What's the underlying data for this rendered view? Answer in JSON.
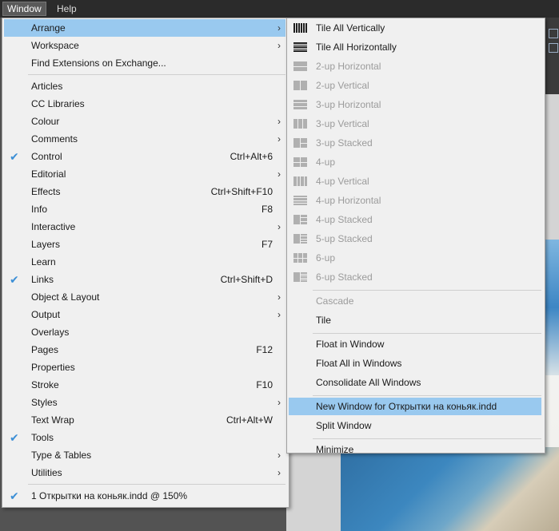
{
  "menubar": {
    "items": [
      {
        "label": "Window"
      },
      {
        "label": "Help"
      }
    ]
  },
  "window_menu": {
    "items": [
      {
        "label": "Arrange",
        "submenu": true,
        "highlight": true
      },
      {
        "label": "Workspace",
        "submenu": true
      },
      {
        "label": "Find Extensions on Exchange..."
      },
      {
        "sep": true
      },
      {
        "label": "Articles"
      },
      {
        "label": "CC Libraries"
      },
      {
        "label": "Colour",
        "submenu": true
      },
      {
        "label": "Comments",
        "submenu": true
      },
      {
        "label": "Control",
        "shortcut": "Ctrl+Alt+6",
        "checked": true
      },
      {
        "label": "Editorial",
        "submenu": true
      },
      {
        "label": "Effects",
        "shortcut": "Ctrl+Shift+F10"
      },
      {
        "label": "Info",
        "shortcut": "F8"
      },
      {
        "label": "Interactive",
        "submenu": true
      },
      {
        "label": "Layers",
        "shortcut": "F7"
      },
      {
        "label": "Learn"
      },
      {
        "label": "Links",
        "shortcut": "Ctrl+Shift+D",
        "checked": true
      },
      {
        "label": "Object & Layout",
        "submenu": true
      },
      {
        "label": "Output",
        "submenu": true
      },
      {
        "label": "Overlays"
      },
      {
        "label": "Pages",
        "shortcut": "F12"
      },
      {
        "label": "Properties"
      },
      {
        "label": "Stroke",
        "shortcut": "F10"
      },
      {
        "label": "Styles",
        "submenu": true
      },
      {
        "label": "Text Wrap",
        "shortcut": "Ctrl+Alt+W"
      },
      {
        "label": "Tools",
        "checked": true
      },
      {
        "label": "Type & Tables",
        "submenu": true
      },
      {
        "label": "Utilities",
        "submenu": true
      },
      {
        "sep": true
      },
      {
        "label": "1 Открытки на коньяк.indd @ 150%",
        "checked": true
      }
    ]
  },
  "arrange_menu": {
    "items": [
      {
        "label": "Tile All Vertically",
        "icon": "tile-vertical-icon"
      },
      {
        "label": "Tile All Horizontally",
        "icon": "tile-horizontal-icon"
      },
      {
        "label": "2-up Horizontal",
        "icon": "2up-horizontal-icon",
        "disabled": true
      },
      {
        "label": "2-up Vertical",
        "icon": "2up-vertical-icon",
        "disabled": true
      },
      {
        "label": "3-up Horizontal",
        "icon": "3up-horizontal-icon",
        "disabled": true
      },
      {
        "label": "3-up Vertical",
        "icon": "3up-vertical-icon",
        "disabled": true
      },
      {
        "label": "3-up Stacked",
        "icon": "3up-stacked-icon",
        "disabled": true
      },
      {
        "label": "4-up",
        "icon": "4up-icon",
        "disabled": true
      },
      {
        "label": "4-up Vertical",
        "icon": "4up-vertical-icon",
        "disabled": true
      },
      {
        "label": "4-up Horizontal",
        "icon": "4up-horizontal-icon",
        "disabled": true
      },
      {
        "label": "4-up Stacked",
        "icon": "4up-stacked-icon",
        "disabled": true
      },
      {
        "label": "5-up Stacked",
        "icon": "5up-stacked-icon",
        "disabled": true
      },
      {
        "label": "6-up",
        "icon": "6up-icon",
        "disabled": true
      },
      {
        "label": "6-up Stacked",
        "icon": "6up-stacked-icon",
        "disabled": true
      },
      {
        "sep": true
      },
      {
        "label": "Cascade",
        "disabled": true
      },
      {
        "label": "Tile"
      },
      {
        "sep": true
      },
      {
        "label": "Float in Window"
      },
      {
        "label": "Float All in Windows"
      },
      {
        "label": "Consolidate All Windows"
      },
      {
        "sep": true
      },
      {
        "label": "New Window for Открытки на коньяк.indd",
        "highlight": true
      },
      {
        "label": "Split Window"
      },
      {
        "sep": true
      },
      {
        "label": "Minimize"
      }
    ]
  },
  "colors": {
    "highlight": "#99c9ef",
    "check": "#3c8fd6",
    "menubar": "#2b2b2b",
    "menu_bg": "#f0f0f0"
  }
}
